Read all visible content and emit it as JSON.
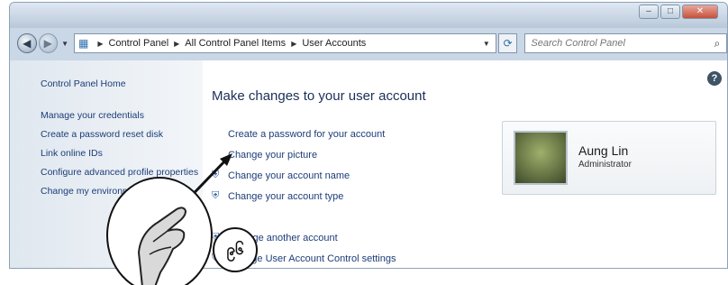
{
  "window": {
    "caption": {
      "minimize": "–",
      "maximize": "□",
      "close": "✕"
    }
  },
  "navbar": {
    "back_icon": "arrow-left",
    "breadcrumb": [
      "Control Panel",
      "All Control Panel Items",
      "User Accounts"
    ],
    "search_placeholder": "Search Control Panel"
  },
  "left_pane": {
    "home": "Control Panel Home",
    "links": [
      "Manage your credentials",
      "Create a password reset disk",
      "Link online IDs",
      "Configure advanced profile properties",
      "Change my environment variables"
    ]
  },
  "main": {
    "title": "Make changes to your user account",
    "tasks": [
      "Create a password for your account",
      "Change your picture",
      "Change your account name",
      "Change your account type"
    ],
    "tasks2": [
      "Manage another account",
      "Change User Account Control settings"
    ]
  },
  "user": {
    "name": "Aung Lin",
    "role": "Administrator"
  },
  "overlay": {
    "badge_text": "၉၆"
  }
}
